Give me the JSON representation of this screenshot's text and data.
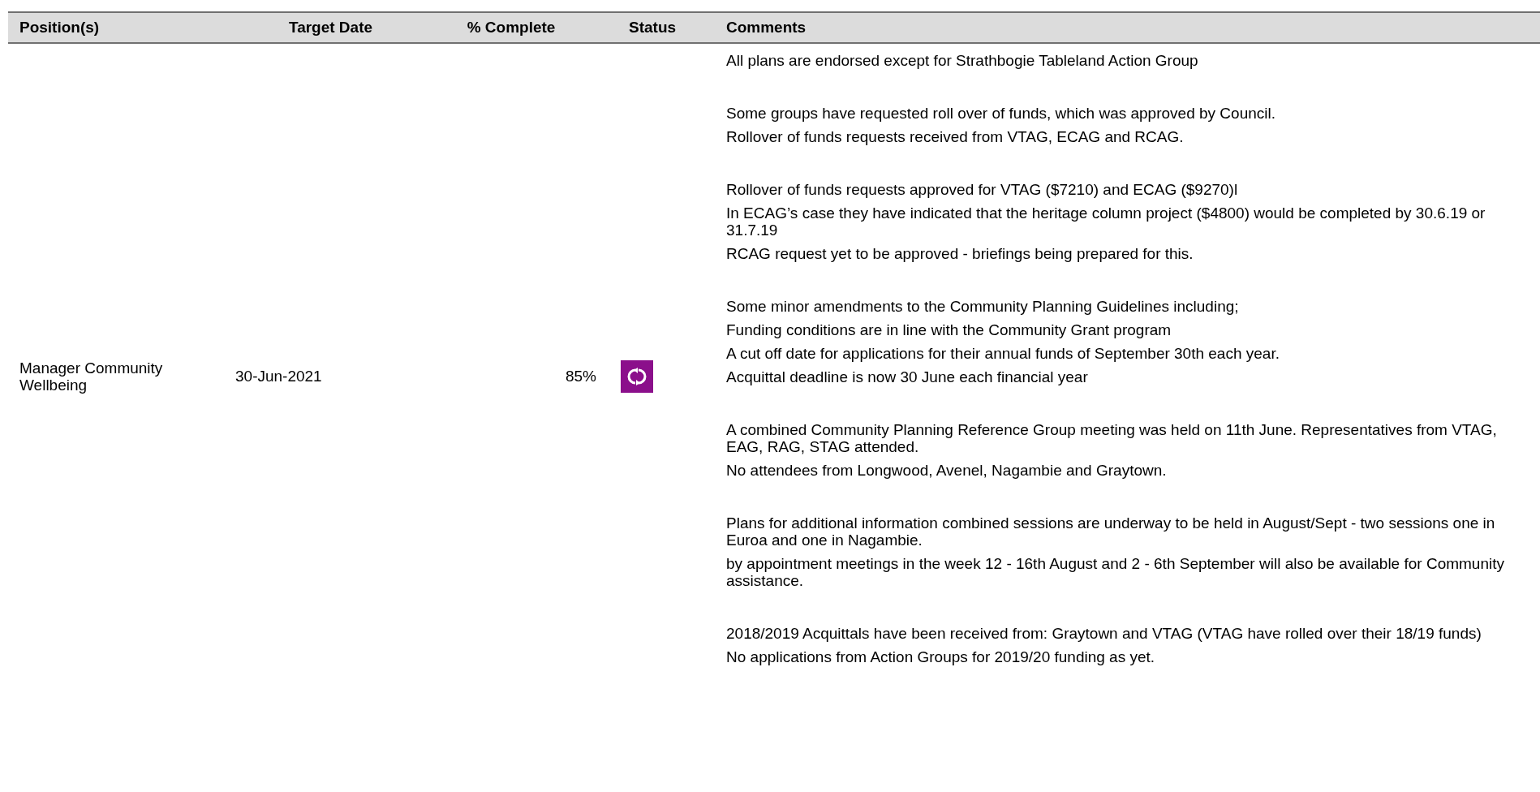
{
  "table": {
    "columns": [
      "Position(s)",
      "Target Date",
      "% Complete",
      "Status",
      "Comments"
    ],
    "rows": [
      {
        "position": "Manager Community Wellbeing",
        "target_date": "30-Jun-2021",
        "percent_complete": "85%",
        "status": {
          "kind": "in_progress"
        },
        "comments": [
          [
            "All plans are endorsed except for Strathbogie Tableland Action Group"
          ],
          [
            "Some groups have requested roll over of funds, which was approved by Council.",
            "Rollover of funds requests received from VTAG, ECAG and RCAG."
          ],
          [
            "Rollover of funds requests approved for VTAG ($7210) and ECAG ($9270)l",
            "In ECAG’s case they have indicated that the heritage column project ($4800) would be completed by 30.6.19 or 31.7.19",
            "RCAG request yet to be approved - briefings being prepared for this."
          ],
          [
            "Some minor amendments to the Community Planning Guidelines including;",
            "Funding conditions are in line with the Community Grant program",
            "A cut off date for applications for their annual funds of September 30th each year.",
            "Acquittal deadline is now 30 June each financial year"
          ],
          [
            "A combined Community Planning Reference Group meeting was held on 11th June. Representatives from VTAG, EAG, RAG, STAG attended.",
            "No attendees from Longwood, Avenel, Nagambie and Graytown."
          ],
          [
            "Plans for additional information combined sessions are underway to be held in August/Sept - two sessions one in Euroa and one in Nagambie.",
            "by appointment meetings in the week 12 - 16th August and 2 - 6th September will also be available for Community assistance."
          ],
          [
            "2018/2019 Acquittals have been received from: Graytown and VTAG (VTAG have rolled over their 18/19 funds)",
            "No applications from Action Groups for 2019/20 funding as yet."
          ]
        ]
      }
    ]
  }
}
